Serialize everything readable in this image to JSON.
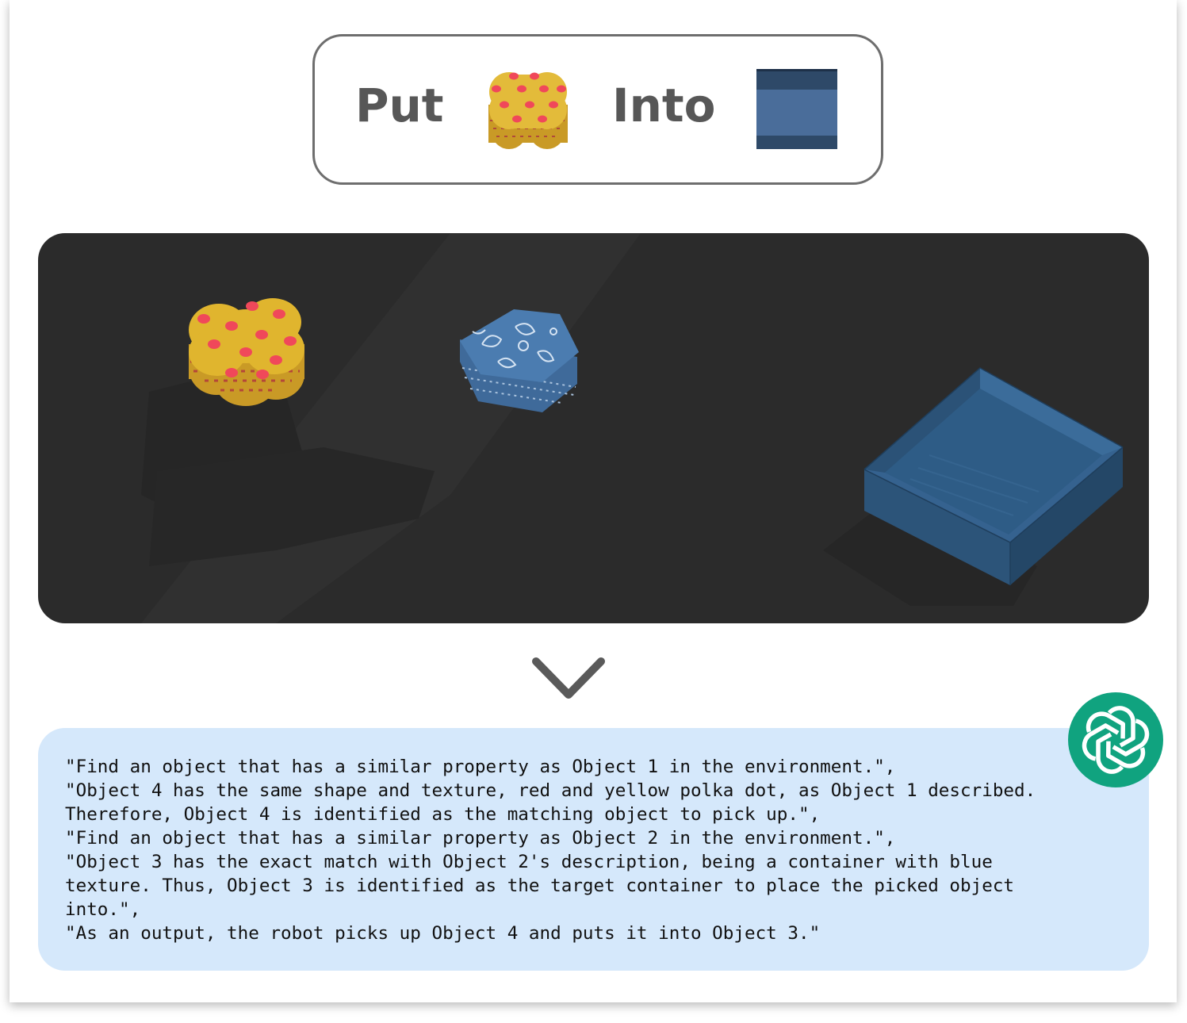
{
  "instruction": {
    "verb": "Put",
    "preposition": "Into",
    "object_icon": "yellow-polka-dot-flower-block-icon",
    "container_icon": "blue-container-icon"
  },
  "scene": {
    "objects": [
      "yellow-red-polka-dot-flower-block",
      "blue-paisley-hexagon-block",
      "blue-open-container"
    ]
  },
  "divider_icon": "chevron-down-icon",
  "reasoning": {
    "lines": [
      "\"Find an object that has a similar property as Object 1 in the environment.\",",
      "\"Object 4 has the same shape and texture, red and yellow polka dot, as Object 1 described.",
      "Therefore, Object 4 is identified as the matching object to pick up.\",",
      "\"Find an object that has a similar property as Object 2 in the environment.\",",
      "\"Object 3 has the exact match with Object 2's description, being a container with blue",
      "texture. Thus, Object 3 is identified as the target container to place the picked object",
      "into.\",",
      "\"As an output, the robot picks up Object 4 and puts it into Object 3.\""
    ]
  },
  "assistant_icon": "openai-logo-icon",
  "colors": {
    "instruction_text": "#575757",
    "scene_bg": "#2b2b2b",
    "bubble_bg": "#d5e8fb",
    "logo_bg": "#10a37f",
    "block_yellow": "#dbb12c",
    "dot_red": "#f0485a",
    "container_blue": "#2f5f8c"
  }
}
